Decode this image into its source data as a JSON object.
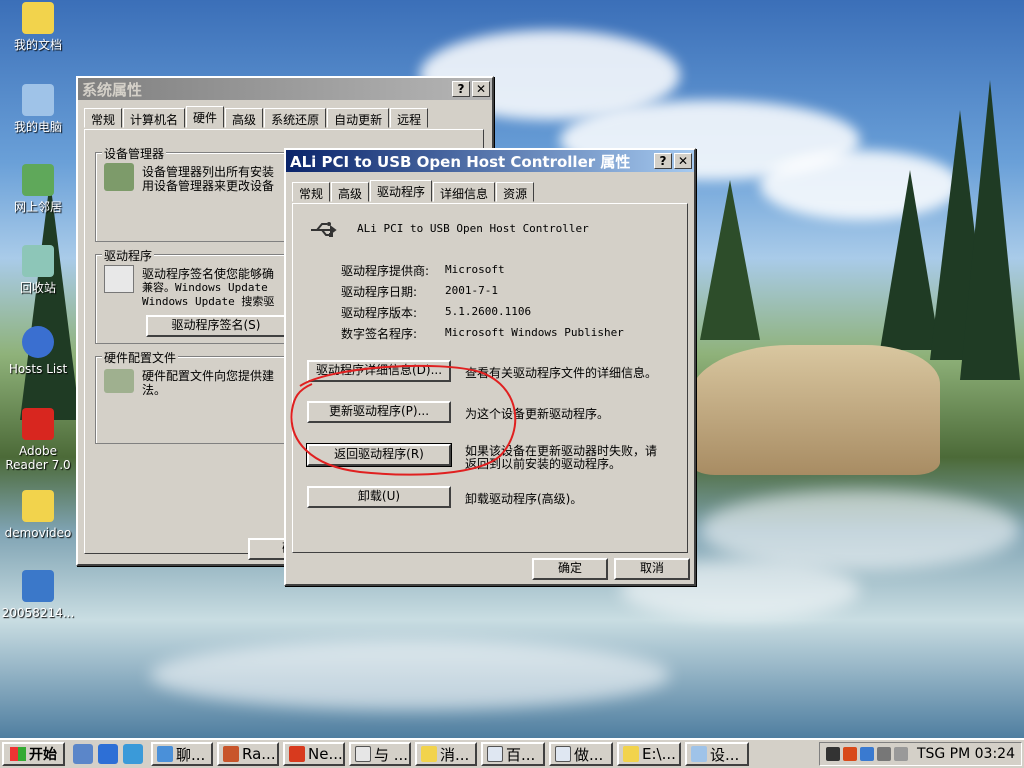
{
  "desktop": {
    "icons": [
      {
        "label": "我的文档"
      },
      {
        "label": "我的电脑"
      },
      {
        "label": "网上邻居"
      },
      {
        "label": "回收站"
      },
      {
        "label": "Hosts List"
      },
      {
        "label": "Adobe Reader 7.0"
      },
      {
        "label": "demovideo"
      },
      {
        "label": "20058214..."
      }
    ]
  },
  "sys_props": {
    "title": "系统属性",
    "help_btn": "?",
    "close_btn": "✕",
    "tabs": [
      "常规",
      "计算机名",
      "硬件",
      "高级",
      "系统还原",
      "自动更新",
      "远程"
    ],
    "selected_tab": "硬件",
    "device_manager": {
      "legend": "设备管理器",
      "line1": "设备管理器列出所有安装",
      "line2": "用设备管理器来更改设备"
    },
    "drivers": {
      "legend": "驱动程序",
      "line1": "驱动程序签名使您能够确",
      "line2": "兼容。Windows Update",
      "line3": "Windows Update 搜索驱",
      "sign_button": "驱动程序签名(S)"
    },
    "hw_profiles": {
      "legend": "硬件配置文件",
      "line1": "硬件配置文件向您提供建",
      "line2": "法。"
    },
    "ok_fragment": "确"
  },
  "ali_props": {
    "title": "ALi PCI to USB Open Host Controller 属性",
    "help_btn": "?",
    "close_btn": "✕",
    "tabs": [
      "常规",
      "高级",
      "驱动程序",
      "详细信息",
      "资源"
    ],
    "selected_tab": "驱动程序",
    "device_name": "ALi PCI to USB Open Host Controller",
    "fields": [
      {
        "label": "驱动程序提供商:",
        "value": "Microsoft"
      },
      {
        "label": "驱动程序日期:",
        "value": "2001-7-1"
      },
      {
        "label": "驱动程序版本:",
        "value": "5.1.2600.1106"
      },
      {
        "label": "数字签名程序:",
        "value": "Microsoft Windows Publisher"
      }
    ],
    "actions": [
      {
        "button": "驱动程序详细信息(D)...",
        "desc": "查看有关驱动程序文件的详细信息。"
      },
      {
        "button": "更新驱动程序(P)...",
        "desc": "为这个设备更新驱动程序。"
      },
      {
        "button": "返回驱动程序(R)",
        "desc": "如果该设备在更新驱动器时失败，请",
        "desc2": "返回到以前安装的驱动程序。"
      },
      {
        "button": "卸载(U)",
        "desc": "卸载驱动程序(高级)。"
      }
    ],
    "ok_button": "确定",
    "cancel_button": "取消"
  },
  "taskbar": {
    "start_label": "开始",
    "tasks": [
      "聊...",
      "Ra...",
      "Ne...",
      "与 ...",
      "消...",
      "百...",
      "做...",
      "E:\\...",
      "设..."
    ],
    "clock": "TSG PM 03:24"
  },
  "colors": {
    "annotation_red": "#e02020",
    "active_title": "#0a246a",
    "face": "#d4d0c8"
  }
}
